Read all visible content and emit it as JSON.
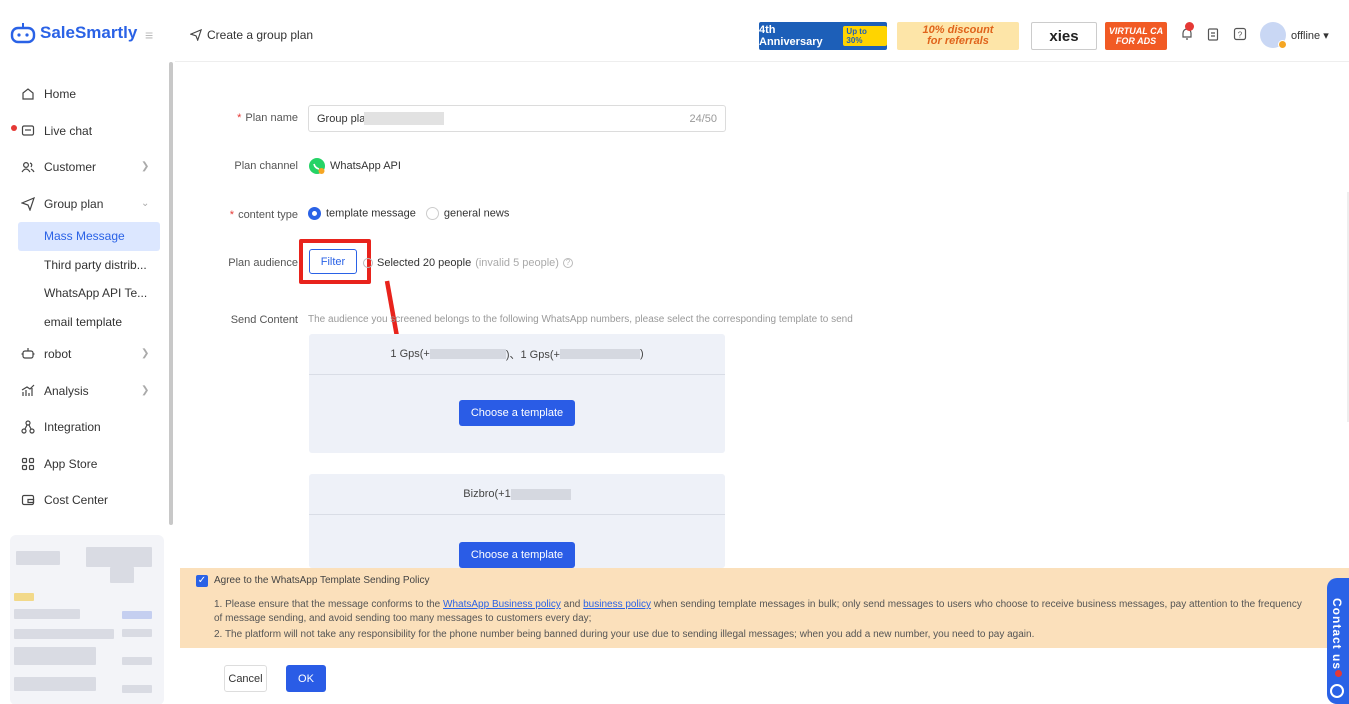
{
  "app": {
    "name": "SaleSmartly"
  },
  "header": {
    "title": "Create a group plan",
    "banners": [
      {
        "name": "anniversary",
        "text": "4th Anniversary",
        "badge": "Up to 30%",
        "bg": "#1d5fb8",
        "color": "#ffffff"
      },
      {
        "name": "referral",
        "text": "10% discount",
        "text2": "for referrals",
        "bg": "#fde5a8",
        "color": "#e0641b"
      },
      {
        "name": "proxies",
        "text": "xies",
        "bg": "#ffffff",
        "color": "#222222"
      },
      {
        "name": "virtual-card",
        "text": "VIRTUAL CA",
        "text2": "FOR ADS",
        "bg": "#f15a24",
        "color": "#ffffff"
      }
    ],
    "status": "offline"
  },
  "sidebar": {
    "items": [
      {
        "label": "Home",
        "icon": "home-icon"
      },
      {
        "label": "Live chat",
        "icon": "chat-icon",
        "dot": true
      },
      {
        "label": "Customer",
        "icon": "users-icon",
        "chevron": true
      },
      {
        "label": "Group plan",
        "icon": "send-icon",
        "chevron": true,
        "expanded": true
      },
      {
        "label": "robot",
        "icon": "robot-icon",
        "chevron": true
      },
      {
        "label": "Analysis",
        "icon": "chart-icon",
        "chevron": true
      },
      {
        "label": "Integration",
        "icon": "integration-icon"
      },
      {
        "label": "App Store",
        "icon": "grid-icon"
      },
      {
        "label": "Cost Center",
        "icon": "wallet-icon"
      }
    ],
    "sub_items": [
      {
        "label": "Mass Message",
        "active": true
      },
      {
        "label": "Third party distrib..."
      },
      {
        "label": "WhatsApp API Te..."
      },
      {
        "label": "email template"
      }
    ]
  },
  "form": {
    "plan_name_label": "Plan name",
    "plan_name_value": "Group pla",
    "plan_name_count": "24/50",
    "plan_channel_label": "Plan channel",
    "plan_channel_value": "WhatsApp API",
    "content_type_label": "content type",
    "content_type_options": [
      "template message",
      "general news"
    ],
    "audience_label": "Plan audience",
    "filter_label": "Filter",
    "audience_selected": "Selected 20 people",
    "audience_invalid": "(invalid 5 people)",
    "send_content_label": "Send Content",
    "send_content_hint": "The audience you screened belongs to the following WhatsApp numbers, please select the corresponding template to send",
    "groups": [
      {
        "title_a": "1 Gps(+",
        "title_b": ")、1 Gps(+",
        "title_c": ")",
        "button": "Choose a template"
      },
      {
        "title_a": "Bizbro(+1",
        "button": "Choose a template"
      }
    ]
  },
  "policy": {
    "agree": "Agree to the WhatsApp Template Sending Policy",
    "line1_a": "1. Please ensure that the message conforms to the ",
    "link1": "WhatsApp Business policy",
    "line1_b": " and ",
    "link2": "business policy",
    "line1_c": " when sending template messages in bulk; only send messages to users who choose to receive business messages, pay attention to the frequency",
    "line1_d": "of message sending, and avoid sending too many messages to customers every day;",
    "line2": "2. The platform will not take any responsibility for the phone number being banned during your use due to sending illegal messages; when you add a new number, you need to pay again."
  },
  "footer": {
    "cancel": "Cancel",
    "ok": "OK"
  },
  "contact": "Contact us",
  "colors": {
    "accent": "#2a62e6",
    "highlight": "#e8231c",
    "policy_bg": "#fbe0bb"
  }
}
